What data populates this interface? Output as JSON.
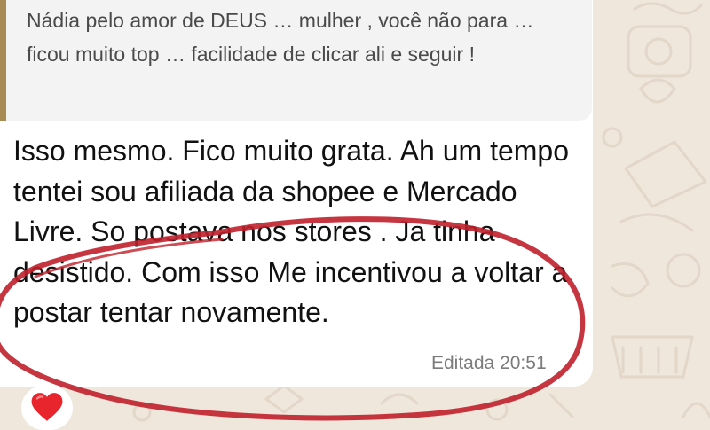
{
  "chat": {
    "quoted_message": "Nádia pelo amor de DEUS … mulher , você não para … ficou muito top … facilidade de clicar ali e seguir !",
    "message_text": "Isso mesmo. Fico muito grata. Ah um tempo tentei sou afiliada da shopee e Mercado Livre. So postava  nos stores . Ja tinha desistido. Com isso Me incentivou a voltar a postar tentar novamente.",
    "edited_label": "Editada",
    "time": "20:51",
    "reaction": {
      "icon": "red-heart-icon",
      "color": "#e8242c"
    }
  },
  "colors": {
    "wallpaper": "#efe7dc",
    "quote_bar": "#a88a55",
    "annotation_ink": "#c0202b"
  }
}
